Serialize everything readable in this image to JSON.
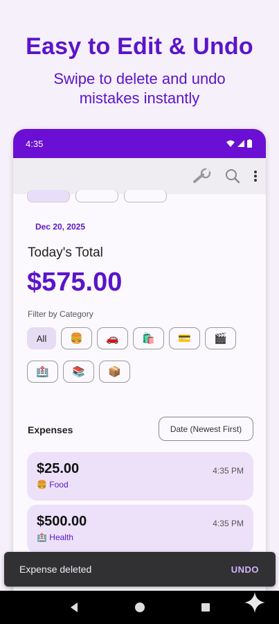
{
  "promo": {
    "title": "Easy to Edit & Undo",
    "subtitle_line1": "Swipe to delete and undo",
    "subtitle_line2": "mistakes instantly"
  },
  "status_bar": {
    "time": "4:35"
  },
  "app_bar": {
    "icons": [
      "wrench-icon",
      "search-icon",
      "more-vert-icon"
    ]
  },
  "date": "Dec 20, 2025",
  "summary": {
    "label": "Today's Total",
    "value": "$575.00"
  },
  "filter": {
    "label": "Filter by Category",
    "chips_row1": [
      {
        "label": "All"
      },
      {
        "label": "🍔",
        "icon": "food-icon"
      },
      {
        "label": "🚗",
        "icon": "car-icon"
      },
      {
        "label": "🛍️",
        "icon": "shopping-icon"
      },
      {
        "label": "💳",
        "icon": "credit-card-icon"
      },
      {
        "label": "🎬",
        "icon": "entertainment-icon"
      }
    ],
    "chips_row2": [
      {
        "label": "🏥",
        "icon": "health-icon"
      },
      {
        "label": "📚",
        "icon": "education-icon"
      },
      {
        "label": "📦",
        "icon": "other-icon"
      }
    ]
  },
  "expenses": {
    "label": "Expenses",
    "sort_label": "Date (Newest First)",
    "items": [
      {
        "amount": "$25.00",
        "time": "4:35 PM",
        "category": "🍔 Food"
      },
      {
        "amount": "$500.00",
        "time": "4:35 PM",
        "category": "🏥 Health"
      }
    ]
  },
  "snackbar": {
    "message": "Expense deleted",
    "action": "UNDO"
  },
  "colors": {
    "accent": "#5b14c9",
    "status_bar": "#6a0fd3",
    "card": "#ece1f8"
  }
}
